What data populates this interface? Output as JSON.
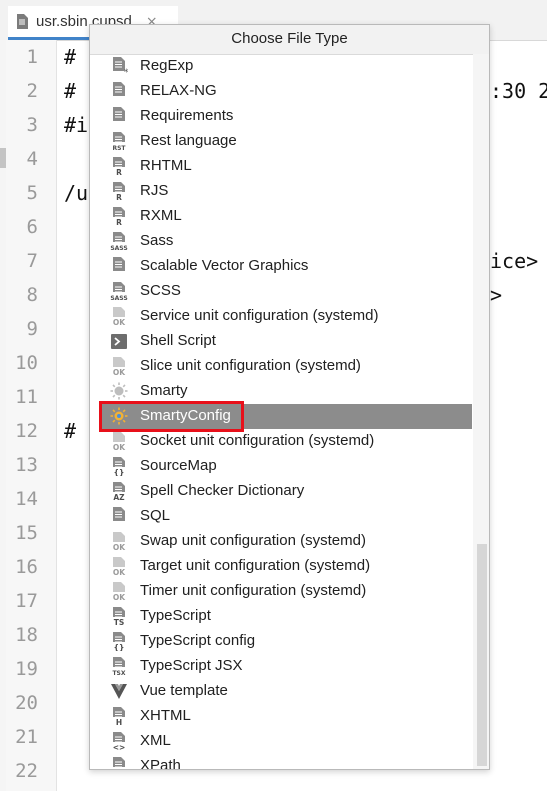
{
  "editor": {
    "tab_label": "usr.sbin.cupsd",
    "tab_close": "×",
    "line_numbers": [
      "1",
      "2",
      "3",
      "4",
      "5",
      "6",
      "7",
      "8",
      "9",
      "10",
      "11",
      "12",
      "13",
      "14",
      "15",
      "16",
      "17",
      "18",
      "19",
      "20",
      "21",
      "22"
    ],
    "code_fragments": {
      "l1": "#",
      "l2": "#",
      "l2_right": ":30 2",
      "l3": "#i",
      "l5": "/u",
      "l7_right": "ice>",
      "l8_right": ">",
      "l12": "#"
    }
  },
  "dialog": {
    "title": "Choose File Type",
    "selected_index": 14,
    "items": [
      {
        "label": "RegExp",
        "icon": "regexp-icon"
      },
      {
        "label": "RELAX-NG",
        "icon": "relaxng-icon"
      },
      {
        "label": "Requirements",
        "icon": "requirements-icon"
      },
      {
        "label": "Rest language",
        "icon": "rst-icon"
      },
      {
        "label": "RHTML",
        "icon": "rhtml-icon"
      },
      {
        "label": "RJS",
        "icon": "rjs-icon"
      },
      {
        "label": "RXML",
        "icon": "rxml-icon"
      },
      {
        "label": "Sass",
        "icon": "sass-icon"
      },
      {
        "label": "Scalable Vector Graphics",
        "icon": "svg-file-icon"
      },
      {
        "label": "SCSS",
        "icon": "scss-icon"
      },
      {
        "label": "Service unit configuration (systemd)",
        "icon": "systemd-service-icon"
      },
      {
        "label": "Shell Script",
        "icon": "shell-script-icon"
      },
      {
        "label": "Slice unit configuration (systemd)",
        "icon": "systemd-slice-icon"
      },
      {
        "label": "Smarty",
        "icon": "smarty-icon"
      },
      {
        "label": "SmartyConfig",
        "icon": "smarty-config-icon"
      },
      {
        "label": "Socket unit configuration (systemd)",
        "icon": "systemd-socket-icon"
      },
      {
        "label": "SourceMap",
        "icon": "sourcemap-icon"
      },
      {
        "label": "Spell Checker Dictionary",
        "icon": "dictionary-icon"
      },
      {
        "label": "SQL",
        "icon": "sql-icon"
      },
      {
        "label": "Swap unit configuration (systemd)",
        "icon": "systemd-swap-icon"
      },
      {
        "label": "Target unit configuration (systemd)",
        "icon": "systemd-target-icon"
      },
      {
        "label": "Timer unit configuration (systemd)",
        "icon": "systemd-timer-icon"
      },
      {
        "label": "TypeScript",
        "icon": "typescript-icon"
      },
      {
        "label": "TypeScript config",
        "icon": "typescript-config-icon"
      },
      {
        "label": "TypeScript JSX",
        "icon": "tsx-icon"
      },
      {
        "label": "Vue template",
        "icon": "vue-icon"
      },
      {
        "label": "XHTML",
        "icon": "xhtml-icon"
      },
      {
        "label": "XML",
        "icon": "xml-icon"
      },
      {
        "label": "XPath",
        "icon": "xpath-icon"
      }
    ]
  },
  "icon_badges": {
    "rst-icon": "RST",
    "rhtml-icon": "R",
    "rjs-icon": "R",
    "rxml-icon": "R",
    "sass-icon": "SASS",
    "scss-icon": "SASS",
    "systemd-service-icon": "OK",
    "systemd-slice-icon": "OK",
    "systemd-socket-icon": "OK",
    "systemd-swap-icon": "OK",
    "systemd-target-icon": "OK",
    "systemd-timer-icon": "OK",
    "sourcemap-icon": "{}",
    "dictionary-icon": "AZ",
    "typescript-icon": "TS",
    "typescript-config-icon": "{}",
    "tsx-icon": "TSX",
    "xhtml-icon": "H",
    "xml-icon": "<>",
    "xpath-icon": "//"
  },
  "colors": {
    "selection_bg": "#8c8c8c",
    "highlight_border": "#e8101a",
    "tab_underline": "#4083c9"
  }
}
